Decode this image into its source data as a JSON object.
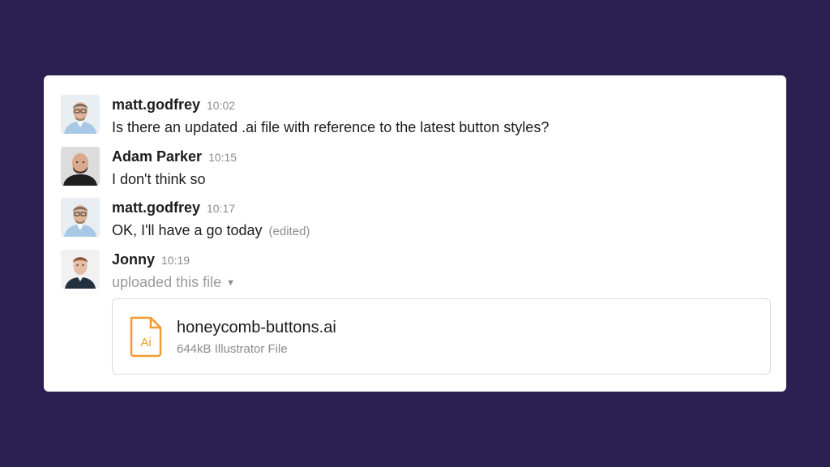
{
  "messages": [
    {
      "author": "matt.godfrey",
      "time": "10:02",
      "text": "Is there an updated .ai file with reference to the latest button styles?"
    },
    {
      "author": "Adam Parker",
      "time": "10:15",
      "text": "I don't think so"
    },
    {
      "author": "matt.godfrey",
      "time": "10:17",
      "text": "OK, I'll have a go today",
      "edited_label": "(edited)"
    },
    {
      "author": "Jonny",
      "time": "10:19",
      "text": "uploaded this file",
      "caret_icon": "chevron-down-icon"
    }
  ],
  "file": {
    "name": "honeycomb-buttons.ai",
    "meta": "644kB Illustrator File",
    "icon_label": "Ai",
    "icon": "illustrator-file-icon"
  },
  "colors": {
    "background": "#2c1f52",
    "card": "#ffffff",
    "text": "#1d1c1d",
    "muted": "#8c8c8c",
    "file_icon": "#f29a2e"
  }
}
